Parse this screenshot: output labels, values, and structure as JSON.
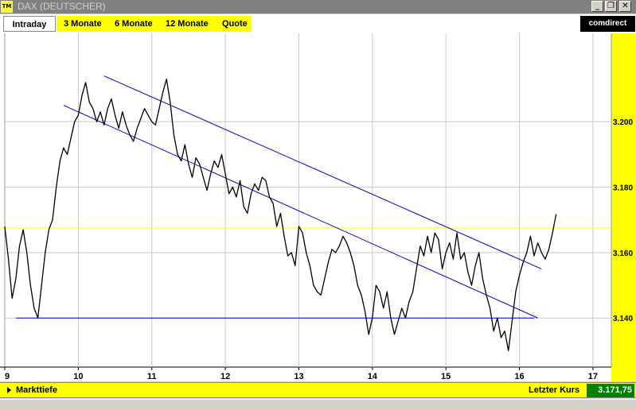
{
  "window": {
    "icon_text": "TM",
    "title": "DAX (DEUTSCHER)",
    "minimize": "_",
    "restore": "❐",
    "close": "✕"
  },
  "tabs": [
    {
      "label": "Intraday"
    },
    {
      "label": "3 Monate"
    },
    {
      "label": "6 Monate"
    },
    {
      "label": "12 Monate"
    },
    {
      "label": "Quote"
    }
  ],
  "logo": "comdirect",
  "footer": {
    "left_label": "Markttiefe",
    "last_label": "Letzter Kurs",
    "last_value": "3.171,75"
  },
  "colors": {
    "accent": "#ffff00",
    "price_line": "#000000",
    "trend_lines": "#0000cc",
    "current_price_line": "#ffff00",
    "value_box": "#008000"
  },
  "chart_data": {
    "type": "line",
    "title": "",
    "xlabel": "",
    "ylabel": "",
    "x_ticks": [
      9,
      10,
      11,
      12,
      13,
      14,
      15,
      16,
      17
    ],
    "x_tick_labels": [
      "9",
      "10",
      "11",
      "12",
      "13",
      "14",
      "15",
      "16",
      "17"
    ],
    "xlim": [
      9,
      17.25
    ],
    "y_ticks": [
      3140,
      3160,
      3180,
      3200
    ],
    "y_tick_labels": [
      "3.140",
      "3.160",
      "3.180",
      "3.200"
    ],
    "ylim": [
      3125,
      3227
    ],
    "grid": true,
    "series": [
      {
        "x": [
          9.0,
          9.05,
          9.1,
          9.15,
          9.2,
          9.25,
          9.3,
          9.35,
          9.4,
          9.45,
          9.5,
          9.55,
          9.6,
          9.65,
          9.7,
          9.75,
          9.8,
          9.85,
          9.9,
          9.95,
          10.0,
          10.05,
          10.1,
          10.15,
          10.2,
          10.25,
          10.3,
          10.35,
          10.4,
          10.45,
          10.5,
          10.55,
          10.6,
          10.65,
          10.7,
          10.75,
          10.8,
          10.85,
          10.9,
          10.95,
          11.0,
          11.05,
          11.1,
          11.15,
          11.2,
          11.25,
          11.3,
          11.35,
          11.4,
          11.45,
          11.5,
          11.55,
          11.6,
          11.65,
          11.7,
          11.75,
          11.8,
          11.85,
          11.9,
          11.95,
          12.0,
          12.05,
          12.1,
          12.15,
          12.2,
          12.25,
          12.3,
          12.35,
          12.4,
          12.45,
          12.5,
          12.55,
          12.6,
          12.65,
          12.7,
          12.75,
          12.8,
          12.85,
          12.9,
          12.95,
          13.0,
          13.05,
          13.1,
          13.15,
          13.2,
          13.25,
          13.3,
          13.35,
          13.4,
          13.45,
          13.5,
          13.55,
          13.6,
          13.65,
          13.7,
          13.75,
          13.8,
          13.85,
          13.9,
          13.95,
          14.0,
          14.05,
          14.1,
          14.15,
          14.2,
          14.25,
          14.3,
          14.35,
          14.4,
          14.45,
          14.5,
          14.55,
          14.6,
          14.65,
          14.7,
          14.75,
          14.8,
          14.85,
          14.9,
          14.95,
          15.0,
          15.05,
          15.1,
          15.15,
          15.2,
          15.25,
          15.3,
          15.35,
          15.4,
          15.45,
          15.5,
          15.55,
          15.6,
          15.65,
          15.7,
          15.75,
          15.8,
          15.85,
          15.9,
          15.95,
          16.0,
          16.05,
          16.1,
          16.15,
          16.2,
          16.25,
          16.3,
          16.35,
          16.4,
          16.45,
          16.5
        ],
        "values": [
          3168,
          3158,
          3146,
          3152,
          3162,
          3167,
          3160,
          3150,
          3143,
          3140,
          3150,
          3160,
          3167,
          3170,
          3180,
          3188,
          3192,
          3190,
          3195,
          3200,
          3202,
          3208,
          3212,
          3206,
          3204,
          3200,
          3203,
          3199,
          3204,
          3207,
          3202,
          3198,
          3203,
          3199,
          3196,
          3194,
          3198,
          3201,
          3204,
          3202,
          3200,
          3199,
          3204,
          3209,
          3213,
          3206,
          3196,
          3190,
          3188,
          3193,
          3187,
          3183,
          3189,
          3187,
          3183,
          3179,
          3184,
          3188,
          3186,
          3190,
          3184,
          3178,
          3180,
          3177,
          3182,
          3174,
          3172,
          3178,
          3181,
          3179,
          3183,
          3182,
          3177,
          3175,
          3168,
          3172,
          3165,
          3159,
          3160,
          3156,
          3168,
          3166,
          3160,
          3156,
          3150,
          3148,
          3147,
          3152,
          3157,
          3161,
          3160,
          3162,
          3165,
          3163,
          3160,
          3156,
          3150,
          3147,
          3142,
          3135,
          3140,
          3150,
          3148,
          3143,
          3148,
          3140,
          3135,
          3139,
          3143,
          3140,
          3145,
          3148,
          3155,
          3162,
          3159,
          3165,
          3160,
          3166,
          3164,
          3155,
          3160,
          3163,
          3158,
          3166,
          3158,
          3160,
          3154,
          3150,
          3156,
          3160,
          3152,
          3147,
          3143,
          3136,
          3140,
          3134,
          3136,
          3130,
          3139,
          3148,
          3153,
          3157,
          3160,
          3165,
          3159,
          3163,
          3160,
          3158,
          3161,
          3166,
          3171.75
        ]
      }
    ],
    "trend_lines": [
      {
        "x": [
          9.8,
          16.25
        ],
        "values": [
          3205,
          3140
        ]
      },
      {
        "x": [
          10.35,
          16.3
        ],
        "values": [
          3214,
          3155
        ]
      },
      {
        "x": [
          9.15,
          16.2
        ],
        "values": [
          3140,
          3140
        ]
      }
    ],
    "current_price_line": 3167.5
  }
}
